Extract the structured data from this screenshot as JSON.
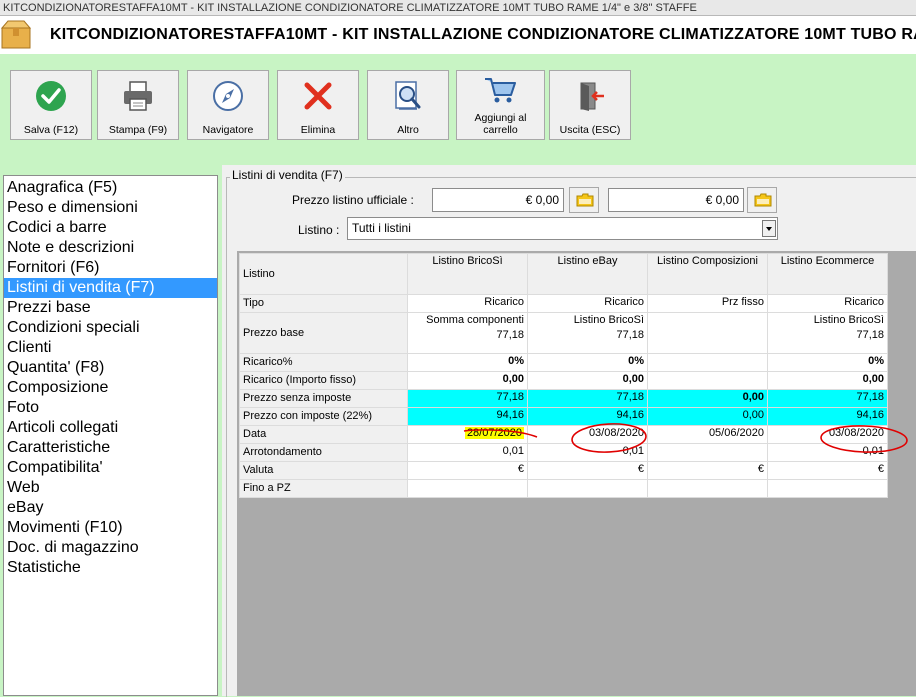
{
  "window": {
    "title": "KITCONDIZIONATORESTAFFA10MT - KIT INSTALLAZIONE CONDIZIONATORE CLIMATIZZATORE 10MT TUBO RAME 1/4\" e 3/8\" STAFFE"
  },
  "header": {
    "title": "KITCONDIZIONATORESTAFFA10MT - KIT INSTALLAZIONE CONDIZIONATORE CLIMATIZZATORE 10MT TUBO RAME 1/4\" e 3/8\" STAFFE",
    "icon": "box-icon"
  },
  "toolbar": {
    "save": {
      "label": "Salva (F12)",
      "icon": "check-circle-icon",
      "color": "#2ea44f"
    },
    "print": {
      "label": "Stampa (F9)",
      "icon": "printer-icon"
    },
    "navigator": {
      "label": "Navigatore",
      "icon": "compass-icon"
    },
    "delete": {
      "label": "Elimina",
      "icon": "red-x-icon",
      "color": "#e0301e"
    },
    "other": {
      "label": "Altro",
      "icon": "document-search-icon"
    },
    "add_cart": {
      "label": "Aggiungi al carrello",
      "icon": "cart-icon"
    },
    "exit": {
      "label": "Uscita (ESC)",
      "icon": "exit-door-icon"
    }
  },
  "sidebar": {
    "items": [
      {
        "label": "Anagrafica (F5)",
        "selected": false
      },
      {
        "label": "Peso e dimensioni",
        "selected": false
      },
      {
        "label": "Codici a barre",
        "selected": false
      },
      {
        "label": "Note e descrizioni",
        "selected": false
      },
      {
        "label": "Fornitori (F6)",
        "selected": false
      },
      {
        "label": "Listini di vendita (F7)",
        "selected": true
      },
      {
        "label": "Prezzi base",
        "selected": false
      },
      {
        "label": "Condizioni speciali",
        "selected": false
      },
      {
        "label": "Clienti",
        "selected": false
      },
      {
        "label": "Quantita' (F8)",
        "selected": false
      },
      {
        "label": "Composizione",
        "selected": false
      },
      {
        "label": "Foto",
        "selected": false
      },
      {
        "label": "Articoli collegati",
        "selected": false
      },
      {
        "label": "Caratteristiche",
        "selected": false
      },
      {
        "label": "Compatibilita'",
        "selected": false
      },
      {
        "label": "Web",
        "selected": false
      },
      {
        "label": "eBay",
        "selected": false
      },
      {
        "label": "Movimenti (F10)",
        "selected": false
      },
      {
        "label": "Doc. di magazzino",
        "selected": false
      },
      {
        "label": "Statistiche",
        "selected": false
      }
    ]
  },
  "panel": {
    "group_title": "Listini di vendita (F7)",
    "official_price_label": "Prezzo listino ufficiale :",
    "official_price_1": "€ 0,00",
    "official_price_2": "€ 0,00",
    "folder_icon": "folder-icon",
    "listino_label": "Listino :",
    "listino_value": "Tutti i listini"
  },
  "grid": {
    "corner_label": "Listino",
    "columns": [
      "Listino BricoSì",
      "Listino eBay",
      "Listino Composizioni",
      "Listino Ecommerce"
    ],
    "rows": [
      {
        "label": "Tipo",
        "values": [
          "Ricarico",
          "Ricarico",
          "Prz fisso",
          "Ricarico"
        ]
      },
      {
        "label": "Prezzo base",
        "lines1": [
          "Somma componenti",
          "Listino BricoSì",
          "",
          "Listino BricoSì"
        ],
        "lines2": [
          "77,18",
          "77,18",
          "",
          "77,18"
        ]
      },
      {
        "label": "Ricarico%",
        "values": [
          "0%",
          "0%",
          "",
          "0%"
        ]
      },
      {
        "label": "Ricarico (Importo fisso)",
        "values": [
          "0,00",
          "0,00",
          "",
          "0,00"
        ]
      },
      {
        "label": "Prezzo senza imposte",
        "values": [
          "77,18",
          "77,18",
          "0,00",
          "77,18"
        ]
      },
      {
        "label": "Prezzo con imposte (22%)",
        "values": [
          "94,16",
          "94,16",
          "0,00",
          "94,16"
        ]
      },
      {
        "label": "Data",
        "values": [
          "28/07/2020",
          "03/08/2020",
          "05/06/2020",
          "03/08/2020"
        ]
      },
      {
        "label": "Arrotondamento",
        "values": [
          "0,01",
          "0,01",
          "",
          "0,01"
        ]
      },
      {
        "label": "Valuta",
        "values": [
          "€",
          "€",
          "€",
          "€"
        ]
      },
      {
        "label": "Fino a PZ",
        "values": [
          "",
          "",
          "",
          ""
        ]
      }
    ],
    "highlight_colors": {
      "cyan": "#00ffff",
      "yellow": "#ffff00",
      "annotation": "#e00000"
    }
  }
}
